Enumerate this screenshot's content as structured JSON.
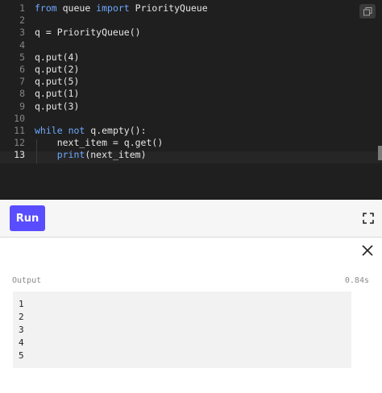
{
  "editor": {
    "lines": [
      {
        "num": "1",
        "tokens": [
          {
            "t": "from",
            "k": true
          },
          {
            "t": " queue ",
            "k": false
          },
          {
            "t": "import",
            "k": true
          },
          {
            "t": " PriorityQueue",
            "k": false
          }
        ]
      },
      {
        "num": "2",
        "tokens": []
      },
      {
        "num": "3",
        "tokens": [
          {
            "t": "q = PriorityQueue()",
            "k": false
          }
        ]
      },
      {
        "num": "4",
        "tokens": []
      },
      {
        "num": "5",
        "tokens": [
          {
            "t": "q.put(4)",
            "k": false
          }
        ]
      },
      {
        "num": "6",
        "tokens": [
          {
            "t": "q.put(2)",
            "k": false
          }
        ]
      },
      {
        "num": "7",
        "tokens": [
          {
            "t": "q.put(5)",
            "k": false
          }
        ]
      },
      {
        "num": "8",
        "tokens": [
          {
            "t": "q.put(1)",
            "k": false
          }
        ]
      },
      {
        "num": "9",
        "tokens": [
          {
            "t": "q.put(3)",
            "k": false
          }
        ]
      },
      {
        "num": "10",
        "tokens": []
      },
      {
        "num": "11",
        "tokens": [
          {
            "t": "while",
            "k": true
          },
          {
            "t": " ",
            "k": false
          },
          {
            "t": "not",
            "k": true
          },
          {
            "t": " q.empty():",
            "k": false
          }
        ]
      },
      {
        "num": "12",
        "tokens": [
          {
            "t": "    next_item = q.get()",
            "k": false
          }
        ]
      },
      {
        "num": "13",
        "tokens": [
          {
            "t": "    ",
            "k": false
          },
          {
            "t": "print",
            "k": true
          },
          {
            "t": "(next_item)",
            "k": false
          }
        ]
      }
    ],
    "active_line": "13",
    "copy_icon": "copy-icon"
  },
  "toolbar": {
    "run_label": "Run",
    "expand_icon": "expand-icon",
    "accent_color": "#5a4dff"
  },
  "output": {
    "label": "Output",
    "time": "0.84s",
    "lines": [
      "1",
      "2",
      "3",
      "4",
      "5"
    ],
    "close_icon": "close-icon"
  }
}
